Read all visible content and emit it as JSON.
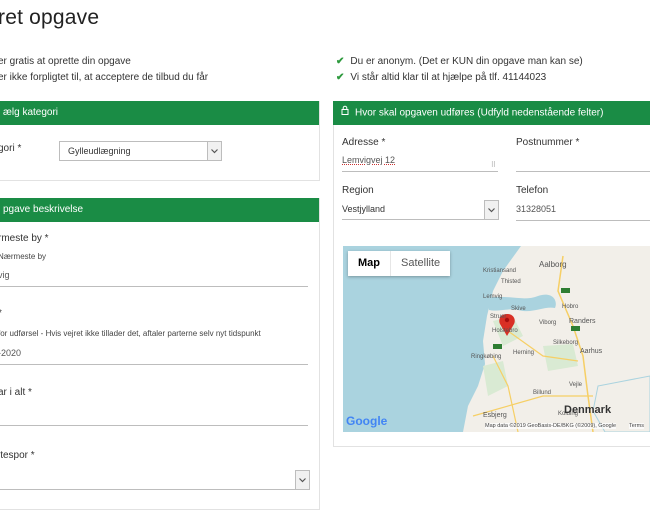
{
  "page": {
    "title": "ret opgave"
  },
  "benefits_left": [
    "er gratis at oprette din opgave",
    "er ikke forpligtet til, at acceptere de tilbud du får"
  ],
  "benefits_right": [
    "Du er anonym. (Det er KUN din opgave man kan se)",
    "Vi står altid klar til at hjælpe på tlf. 41144023"
  ],
  "category": {
    "header": "ælg kategori",
    "field_label": "gori *",
    "selected": "Gylleudlægning"
  },
  "description": {
    "header": "pgave beskrivelse",
    "city_label": "rmeste by *",
    "city_hint": "Nærmeste by",
    "city_value": "vig",
    "date_label": "*",
    "date_hint": "for udførsel - Hvis vejret ikke tillader det, aftaler parterne selv nyt tidspunkt",
    "date_value": "-2020",
    "total_label": "ar i alt *",
    "track_label": "jtespor *"
  },
  "location": {
    "header": "Hvor skal opgaven udføres (Udfyld nedenstående felter)",
    "address_label": "Adresse  *",
    "address_value": "Lemvigvej 12",
    "postal_label": "Postnummer  *",
    "region_label": "Region",
    "region_value": "Vestjylland",
    "phone_label": "Telefon",
    "phone_value": "31328051"
  },
  "map": {
    "map_button": "Map",
    "satellite_button": "Satellite",
    "country": "Denmark",
    "places": [
      "Aalborg",
      "Thisted",
      "Holstebro",
      "Viborg",
      "Randers",
      "Herning",
      "Aarhus",
      "Ringkøbing",
      "Esbjerg",
      "Kolding",
      "Vejle",
      "Billund",
      "Silkeborg",
      "Skive",
      "Struer",
      "Lemvig",
      "Hobro",
      "Kristiansand"
    ],
    "logo": "Google",
    "attribution": "Map data ©2019 GeoBasis-DE/BKG (©2009), Google",
    "terms": "Terms"
  },
  "colors": {
    "accent": "#1a8c45",
    "check": "#2e9a3e",
    "pin": "#d93025"
  }
}
